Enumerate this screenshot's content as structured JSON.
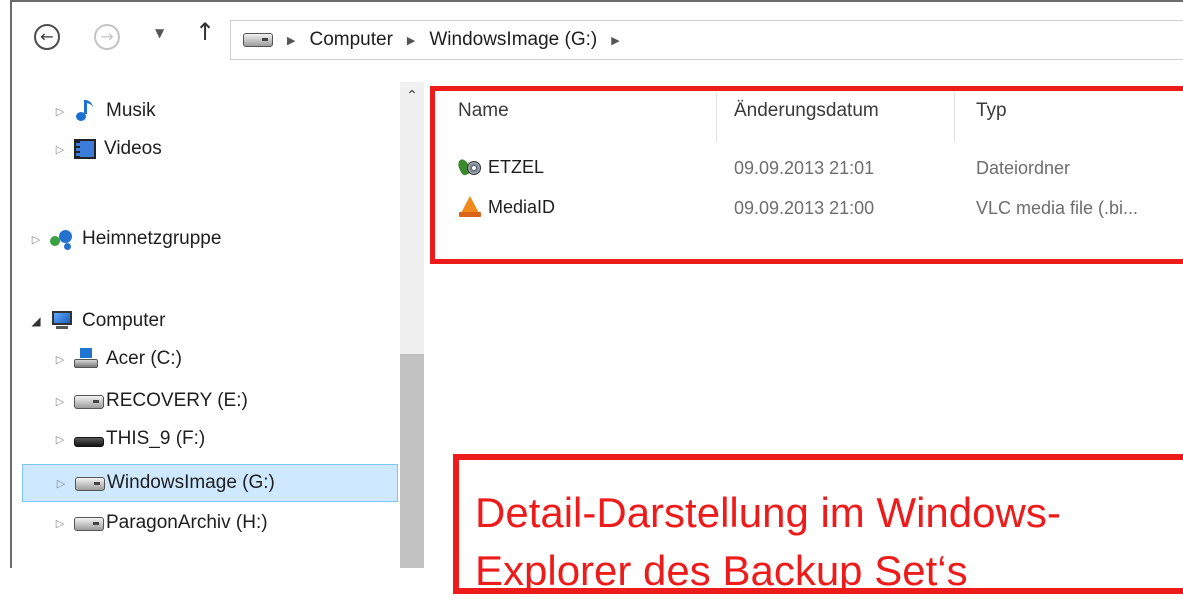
{
  "window": {
    "nav": {
      "back_icon": "back-arrow-icon",
      "forward_icon": "forward-arrow-icon",
      "recent_icon": "chevron-down-icon",
      "up_icon": "up-arrow-icon",
      "back_glyph": "←",
      "forward_glyph": "→",
      "recent_glyph": "▼",
      "up_glyph": "↑"
    },
    "address": {
      "crumbs": [
        "Computer",
        "WindowsImage (G:)"
      ]
    }
  },
  "navpane": {
    "scroll_up_glyph": "⌃",
    "items": [
      {
        "label": "Musik",
        "icon": "music-icon",
        "expanded": false
      },
      {
        "label": "Videos",
        "icon": "video-icon",
        "expanded": false
      },
      {
        "label": "Heimnetzgruppe",
        "icon": "homegroup-icon",
        "expanded": false
      },
      {
        "label": "Computer",
        "icon": "computer-icon",
        "expanded": true
      },
      {
        "label": "Acer (C:)",
        "icon": "windows-drive-icon",
        "expanded": false
      },
      {
        "label": "RECOVERY (E:)",
        "icon": "drive-icon",
        "expanded": false
      },
      {
        "label": "THIS_9 (F:)",
        "icon": "removable-drive-icon",
        "expanded": false
      },
      {
        "label": "WindowsImage (G:)",
        "icon": "drive-icon",
        "expanded": false,
        "selected": true
      },
      {
        "label": "ParagonArchiv (H:)",
        "icon": "drive-icon",
        "expanded": false
      }
    ]
  },
  "filelist": {
    "columns": [
      "Name",
      "Änderungsdatum",
      "Typ"
    ],
    "rows": [
      {
        "name": "ETZEL",
        "date": "09.09.2013 21:01",
        "type": "Dateiordner",
        "icon": "etzel-folder-icon"
      },
      {
        "name": "MediaID",
        "date": "09.09.2013 21:00",
        "type": "VLC media file (.bi...",
        "icon": "vlc-icon"
      }
    ]
  },
  "annotation": {
    "callout_line1": "Detail-Darstellung im Windows-",
    "callout_line2": "Explorer des Backup Set‘s",
    "color": "#ee1b1b"
  },
  "colors": {
    "selection_bg": "#cde8ff",
    "selection_border": "#7cc5f5"
  }
}
